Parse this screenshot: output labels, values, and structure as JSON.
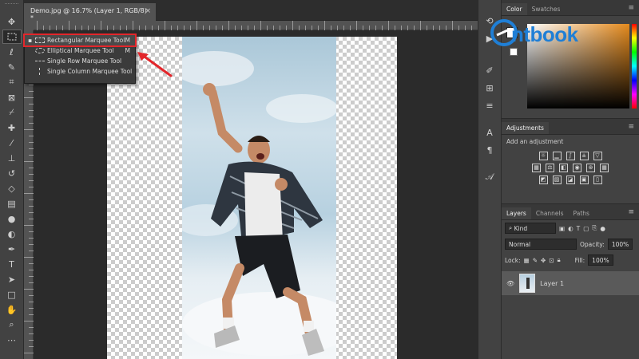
{
  "document_tab": {
    "title": "Demo.jpg @ 16.7% (Layer 1, RGB/8) *",
    "close": "×"
  },
  "toolbar": {
    "tools": [
      "move-tool",
      "marquee-tool",
      "lasso-tool",
      "quick-selection-tool",
      "crop-tool",
      "frame-tool",
      "eyedropper-tool",
      "healing-brush-tool",
      "brush-tool",
      "clone-stamp-tool",
      "history-brush-tool",
      "eraser-tool",
      "gradient-tool",
      "blur-tool",
      "dodge-tool",
      "pen-tool",
      "type-tool",
      "path-selection-tool",
      "rectangle-tool",
      "hand-tool",
      "zoom-tool"
    ]
  },
  "marquee_flyout": {
    "items": [
      {
        "label": "Rectangular Marquee Tool",
        "shortcut": "M",
        "selected": true,
        "bullet": "▪"
      },
      {
        "label": "Elliptical Marquee Tool",
        "shortcut": "M",
        "selected": false,
        "bullet": ""
      },
      {
        "label": "Single Row Marquee Tool",
        "shortcut": "",
        "selected": false,
        "bullet": ""
      },
      {
        "label": "Single Column Marquee Tool",
        "shortcut": "",
        "selected": false,
        "bullet": ""
      }
    ]
  },
  "panels": {
    "color": {
      "tabs": [
        "Color",
        "Swatches"
      ]
    },
    "adjustments": {
      "tabs": [
        "Adjustments"
      ],
      "subtitle": "Add an adjustment"
    },
    "layers": {
      "tabs": [
        "Layers",
        "Channels",
        "Paths"
      ],
      "filter_kind": "Kind",
      "blend_mode": "Normal",
      "opacity_label": "Opacity:",
      "opacity_value": "100%",
      "lock_label": "Lock:",
      "fill_label": "Fill:",
      "fill_value": "100%",
      "layer_name": "Layer 1"
    }
  },
  "watermark": {
    "text": "ntbook"
  },
  "colors": {
    "annotation_red": "#e3262b",
    "brand_blue": "#1f7fd6"
  }
}
